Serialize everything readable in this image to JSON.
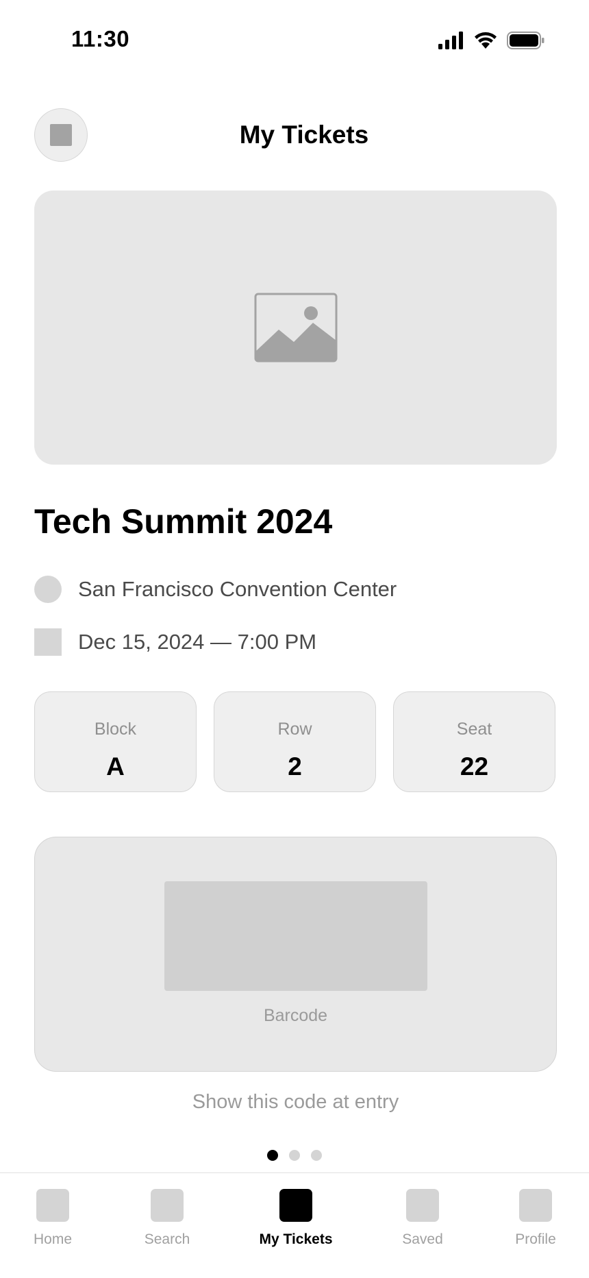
{
  "status_bar": {
    "time": "11:30",
    "icons": [
      "signal-icon",
      "wifi-icon",
      "battery-icon"
    ]
  },
  "header": {
    "title": "My Tickets",
    "back_icon": "back-icon"
  },
  "hero": {
    "icon": "image-placeholder-icon"
  },
  "event": {
    "title": "Tech Summit 2024",
    "location": "San Francisco Convention Center",
    "datetime": "Dec 15, 2024 — 7:00 PM",
    "location_icon": "location-icon",
    "calendar_icon": "calendar-icon"
  },
  "seat": [
    {
      "label": "Block",
      "value": "A"
    },
    {
      "label": "Row",
      "value": "2"
    },
    {
      "label": "Seat",
      "value": "22"
    }
  ],
  "barcode": {
    "label": "Barcode",
    "hint": "Show this code at entry"
  },
  "pagination": {
    "active_index": 0,
    "total": 3
  },
  "tabs": [
    {
      "label": "Home",
      "icon": "home-icon",
      "active": false
    },
    {
      "label": "Search",
      "icon": "search-icon",
      "active": false
    },
    {
      "label": "My Tickets",
      "icon": "ticket-icon",
      "active": true
    },
    {
      "label": "Saved",
      "icon": "bookmark-icon",
      "active": false
    },
    {
      "label": "Profile",
      "icon": "profile-icon",
      "active": false
    }
  ],
  "colors": {
    "placeholder": "#e7e7e7",
    "icon_fill": "#a3a3a3",
    "active": "#000000",
    "muted_text": "#9a9a9a"
  }
}
